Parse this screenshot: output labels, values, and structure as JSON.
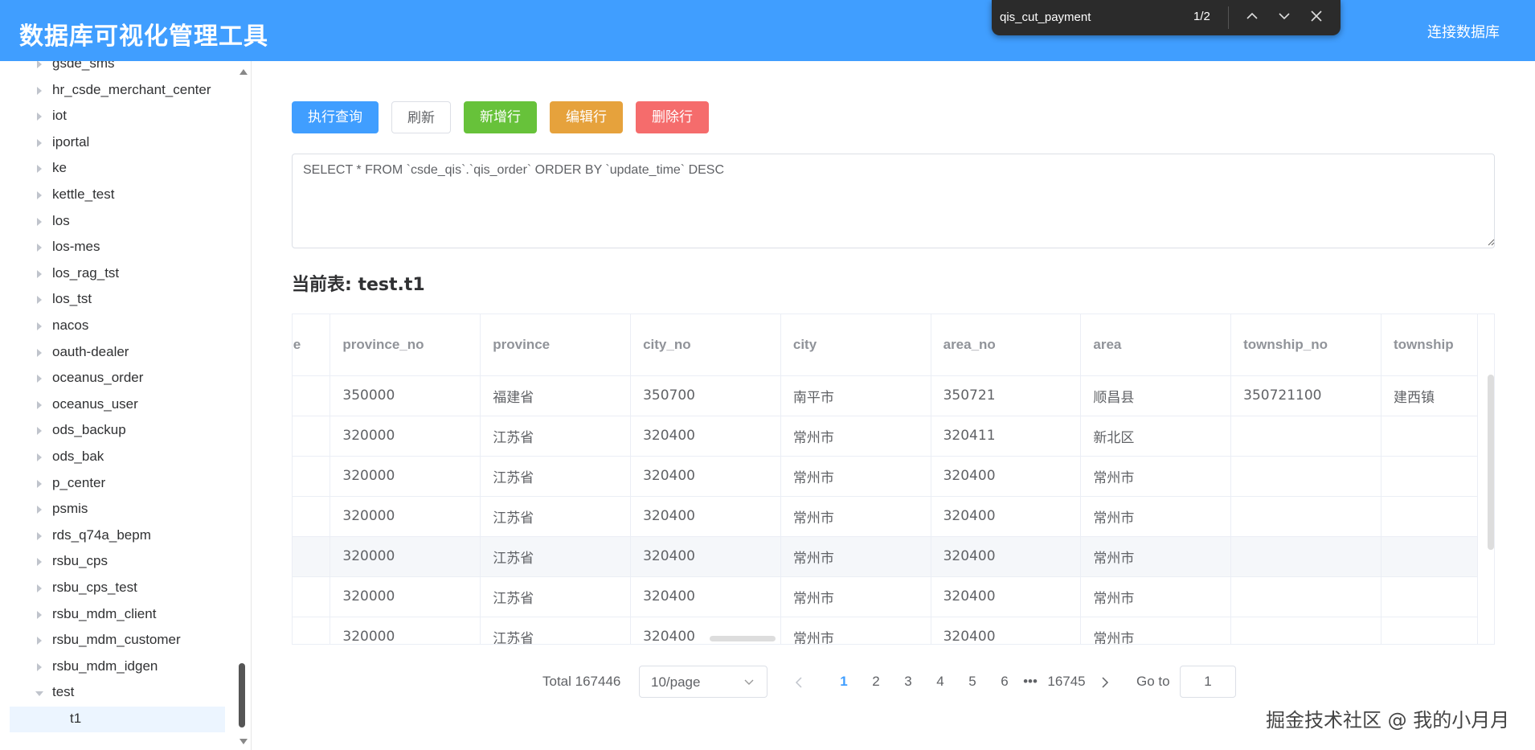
{
  "app": {
    "title": "数据库可视化管理工具",
    "connect_label": "连接数据库"
  },
  "find_bar": {
    "query": "qis_cut_payment",
    "count": "1/2"
  },
  "sidebar": {
    "items": [
      {
        "label": "gsde_sms",
        "expanded": false
      },
      {
        "label": "hr_csde_merchant_center",
        "expanded": false
      },
      {
        "label": "iot",
        "expanded": false
      },
      {
        "label": "iportal",
        "expanded": false
      },
      {
        "label": "ke",
        "expanded": false
      },
      {
        "label": "kettle_test",
        "expanded": false
      },
      {
        "label": "los",
        "expanded": false
      },
      {
        "label": "los-mes",
        "expanded": false
      },
      {
        "label": "los_rag_tst",
        "expanded": false
      },
      {
        "label": "los_tst",
        "expanded": false
      },
      {
        "label": "nacos",
        "expanded": false
      },
      {
        "label": "oauth-dealer",
        "expanded": false
      },
      {
        "label": "oceanus_order",
        "expanded": false
      },
      {
        "label": "oceanus_user",
        "expanded": false
      },
      {
        "label": "ods_backup",
        "expanded": false
      },
      {
        "label": "ods_bak",
        "expanded": false
      },
      {
        "label": "p_center",
        "expanded": false
      },
      {
        "label": "psmis",
        "expanded": false
      },
      {
        "label": "rds_q74a_bepm",
        "expanded": false
      },
      {
        "label": "rsbu_cps",
        "expanded": false
      },
      {
        "label": "rsbu_cps_test",
        "expanded": false
      },
      {
        "label": "rsbu_mdm_client",
        "expanded": false
      },
      {
        "label": "rsbu_mdm_customer",
        "expanded": false
      },
      {
        "label": "rsbu_mdm_idgen",
        "expanded": false
      },
      {
        "label": "test",
        "expanded": true
      }
    ],
    "child": {
      "label": "t1"
    }
  },
  "toolbar": {
    "execute": "执行查询",
    "refresh": "刷新",
    "add": "新增行",
    "edit": "编辑行",
    "delete": "删除行"
  },
  "sql": "SELECT * FROM `csde_qis`.`qis_order` ORDER BY `update_time` DESC",
  "current_table": "当前表: test.t1",
  "table": {
    "columns": [
      "ode",
      "province_no",
      "province",
      "city_no",
      "city",
      "area_no",
      "area",
      "township_no",
      "township"
    ],
    "rows": [
      [
        "",
        "350000",
        "福建省",
        "350700",
        "南平市",
        "350721",
        "顺昌县",
        "350721100",
        "建西镇"
      ],
      [
        "",
        "320000",
        "江苏省",
        "320400",
        "常州市",
        "320411",
        "新北区",
        "",
        ""
      ],
      [
        "",
        "320000",
        "江苏省",
        "320400",
        "常州市",
        "320400",
        "常州市",
        "",
        ""
      ],
      [
        "",
        "320000",
        "江苏省",
        "320400",
        "常州市",
        "320400",
        "常州市",
        "",
        ""
      ],
      [
        "",
        "320000",
        "江苏省",
        "320400",
        "常州市",
        "320400",
        "常州市",
        "",
        ""
      ],
      [
        "",
        "320000",
        "江苏省",
        "320400",
        "常州市",
        "320400",
        "常州市",
        "",
        ""
      ],
      [
        "",
        "320000",
        "江苏省",
        "320400",
        "常州市",
        "320400",
        "常州市",
        "",
        ""
      ]
    ],
    "highlight_row": 4
  },
  "pagination": {
    "total": "Total 167446",
    "page_size": "10/page",
    "pages": [
      "1",
      "2",
      "3",
      "4",
      "5",
      "6"
    ],
    "ellipsis": "•••",
    "last": "16745",
    "current": "1",
    "goto_label": "Go to",
    "goto_value": "1"
  },
  "watermark": "掘金技术社区 @ 我的小月月",
  "colors": {
    "primary": "#409eff",
    "success": "#67c23a",
    "warning": "#e6a23c",
    "danger": "#f56c6c"
  }
}
